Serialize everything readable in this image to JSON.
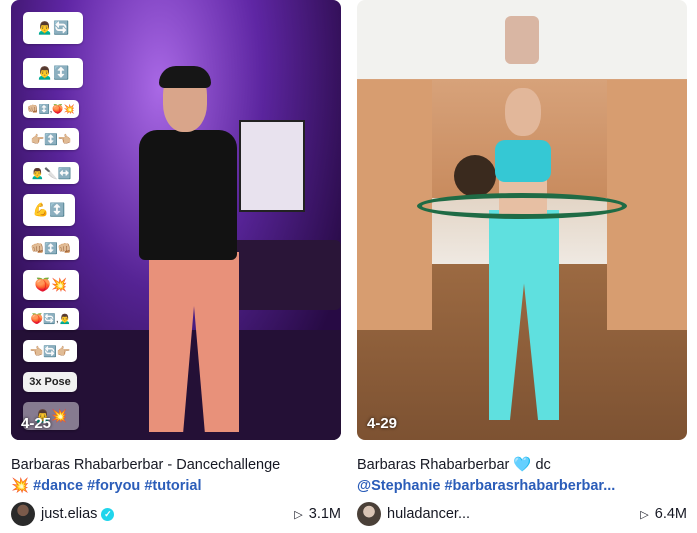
{
  "videos": [
    {
      "badge": "4-25",
      "title_text": "Barbaras Rhabarberbar - Dancechallenge",
      "title_emoji": "💥",
      "hashtags": [
        "#dance",
        "#foryou",
        "#tutorial"
      ],
      "author": "just.elias",
      "verified": true,
      "views": "3.1M",
      "stickers": [
        "🙍‍♂️🔄",
        "🙍‍♂️↕️",
        "👊🏼↕️,🍑💥",
        "👉🏼↕️👈🏼",
        "🙍‍♂️🔪↔️",
        "💪↕️",
        "👊🏼↕️👊🏼",
        "🍑💥",
        "🍑🔄,🙍‍♂️",
        "👈🏼🔄👉🏼",
        "3x Pose",
        "🙍‍♂️💥"
      ]
    },
    {
      "badge": "4-29",
      "title_text": "Barbaras Rhabarberbar",
      "title_emoji": "🩵",
      "title_suffix": "dc",
      "mention": "@Stephanie",
      "hashtags": [
        "#barbarasrhabarberbar..."
      ],
      "author": "huladancer...",
      "verified": false,
      "views": "6.4M"
    }
  ]
}
